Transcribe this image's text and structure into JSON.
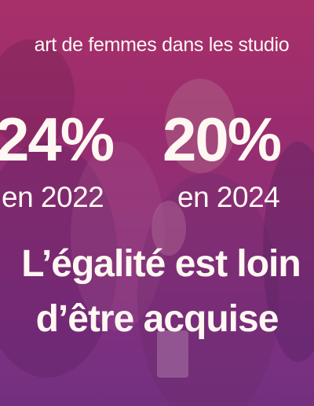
{
  "header": {
    "text": "art de femmes dans les studio"
  },
  "stats": [
    {
      "value": "24%",
      "year": "en 2022"
    },
    {
      "value": "20%",
      "year": "en 2024"
    }
  ],
  "message": {
    "line1": "L’égalité est loin",
    "line2": "d’être acquise"
  },
  "colors": {
    "background_top": "#a8306a",
    "background_bottom": "#73307f",
    "text": "#fff7f2"
  }
}
